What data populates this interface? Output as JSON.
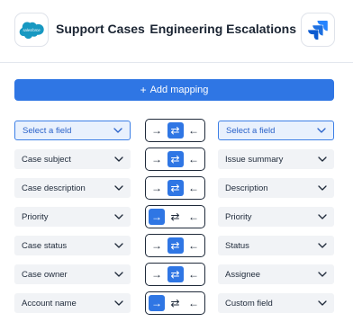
{
  "header": {
    "left_app": {
      "name": "Support Cases",
      "logo_text": "salesforce",
      "logo_color": "#1798c1"
    },
    "right_app": {
      "name": "Engineering Escalations",
      "logo_color": "#2684ff"
    }
  },
  "add_button": {
    "label": "Add mapping",
    "icon": "plus-icon"
  },
  "accent_color": "#2f76e4",
  "direction_icons": [
    "arrow-right-icon",
    "arrows-bidirectional-icon",
    "arrow-left-icon"
  ],
  "direction_glyphs": {
    "right": "→",
    "both": "⇄",
    "left": "←"
  },
  "mappings": [
    {
      "source": "Select a field",
      "target": "Select a field",
      "placeholder": true,
      "direction": "both"
    },
    {
      "source": "Case subject",
      "target": "Issue summary",
      "placeholder": false,
      "direction": "both"
    },
    {
      "source": "Case description",
      "target": "Description",
      "placeholder": false,
      "direction": "both"
    },
    {
      "source": "Priority",
      "target": "Priority",
      "placeholder": false,
      "direction": "right"
    },
    {
      "source": "Case status",
      "target": "Status",
      "placeholder": false,
      "direction": "both"
    },
    {
      "source": "Case owner",
      "target": "Assignee",
      "placeholder": false,
      "direction": "both"
    },
    {
      "source": "Account name",
      "target": "Custom field",
      "placeholder": false,
      "direction": "right"
    }
  ]
}
